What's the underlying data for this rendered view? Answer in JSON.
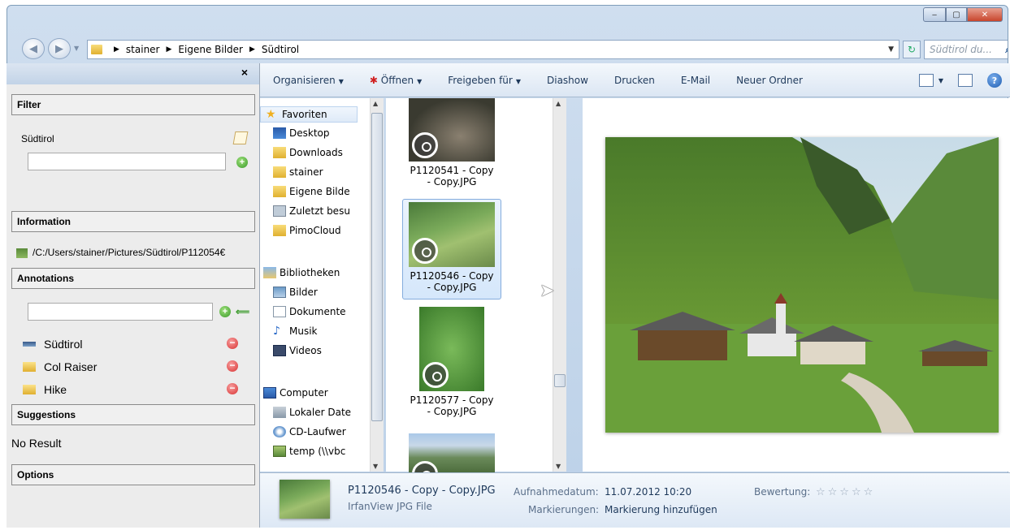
{
  "window": {
    "min_label": "‒",
    "max_label": "▢",
    "close_label": "✕"
  },
  "address": {
    "crumbs": [
      "stainer",
      "Eigene Bilder",
      "Südtirol"
    ],
    "search_placeholder": "Südtirol du..."
  },
  "left_panel": {
    "close_label": "×",
    "filter": {
      "header": "Filter",
      "tag": "Südtirol"
    },
    "information": {
      "header": "Information",
      "path": "/C:/Users/stainer/Pictures/Südtirol/P112054€"
    },
    "annotations": {
      "header": "Annotations",
      "items": [
        {
          "label": "Südtirol",
          "icon": "panorama-icon"
        },
        {
          "label": "Col Raiser",
          "icon": "folder-icon"
        },
        {
          "label": "Hike",
          "icon": "folder-icon"
        }
      ]
    },
    "suggestions": {
      "header": "Suggestions",
      "result": "No Result"
    },
    "options": {
      "header": "Options"
    }
  },
  "toolbar": {
    "organize": "Organisieren",
    "open": "Öffnen",
    "share": "Freigeben für",
    "slideshow": "Diashow",
    "print": "Drucken",
    "email": "E-Mail",
    "new_folder": "Neuer Ordner"
  },
  "nav": {
    "favorites": "Favoriten",
    "fav_items": [
      "Desktop",
      "Downloads",
      "stainer",
      "Eigene Bilde",
      "Zuletzt besu",
      "PimoCloud"
    ],
    "libraries": "Bibliotheken",
    "lib_items": [
      "Bilder",
      "Dokumente",
      "Musik",
      "Videos"
    ],
    "computer": "Computer",
    "comp_items": [
      "Lokaler Date",
      "CD-Laufwer",
      "temp (\\\\vbc"
    ]
  },
  "files": [
    {
      "name_line1": "P1120541 - Copy",
      "name_line2": "- Copy.JPG",
      "selected": false
    },
    {
      "name_line1": "P1120546 - Copy",
      "name_line2": "- Copy.JPG",
      "selected": true
    },
    {
      "name_line1": "P1120577 - Copy",
      "name_line2": "- Copy.JPG",
      "selected": false
    }
  ],
  "details": {
    "filename": "P1120546 - Copy - Copy.JPG",
    "filetype": "IrfanView JPG File",
    "date_label": "Aufnahmedatum:",
    "date_value": "11.07.2012 10:20",
    "tags_label": "Markierungen:",
    "tags_value": "Markierung hinzufügen",
    "rating_label": "Bewertung:",
    "rating_stars": "☆☆☆☆☆"
  }
}
